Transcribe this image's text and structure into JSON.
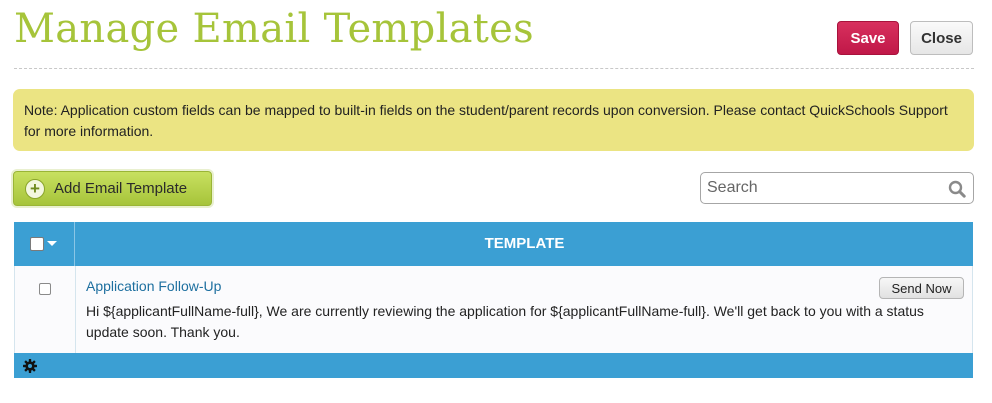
{
  "header": {
    "title": "Manage Email Templates",
    "save_label": "Save",
    "close_label": "Close"
  },
  "note": {
    "text": "Note: Application custom fields can be mapped to built-in fields on the student/parent records upon conversion. Please contact QuickSchools Support for more information."
  },
  "toolbar": {
    "add_label": "Add Email Template",
    "add_icon": "plus-circle-icon",
    "search_placeholder": "Search",
    "search_value": "",
    "search_icon": "search-icon"
  },
  "grid": {
    "columns": [
      "TEMPLATE"
    ],
    "rows": [
      {
        "title": "Application Follow-Up",
        "body": "Hi ${applicantFullName-full}, We are currently reviewing the application for ${applicantFullName-full}. We'll get back to you with a status update soon. Thank you.",
        "action_label": "Send Now",
        "checked": false
      }
    ],
    "footer_icon": "gear-icon"
  },
  "colors": {
    "title": "#a6c43a",
    "save": "#c8204f",
    "note_bg": "#ebe483",
    "add_button": "#b5d14a",
    "grid_header": "#3b9fd3",
    "link": "#1d6f9f"
  }
}
